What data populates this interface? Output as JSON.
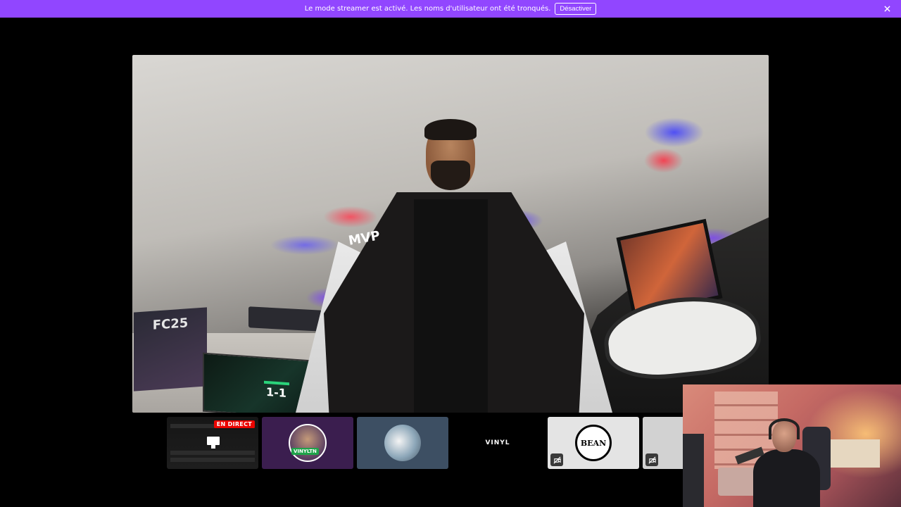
{
  "banner": {
    "message": "Le mode streamer est activé. Les noms d'utilisateur ont été tronqués.",
    "disable_label": "Désactiver",
    "background": "#9146ff"
  },
  "main_video": {
    "poster_text": "FC25",
    "jacket_patch": "MVP",
    "screen_score": "1-1"
  },
  "thumbnails": [
    {
      "type": "screen-share",
      "badge": "EN DIRECT"
    },
    {
      "type": "avatar",
      "tag": "VINYLTN"
    },
    {
      "type": "avatar"
    },
    {
      "type": "avatar",
      "logo_text": "VINYL"
    },
    {
      "type": "avatar",
      "logo_text": "BEAN",
      "muted_icon": "video-off-icon"
    },
    {
      "type": "avatar",
      "muted_icon": "video-off-icon"
    }
  ],
  "colors": {
    "live_badge": "#eb0400",
    "background": "#000000"
  }
}
